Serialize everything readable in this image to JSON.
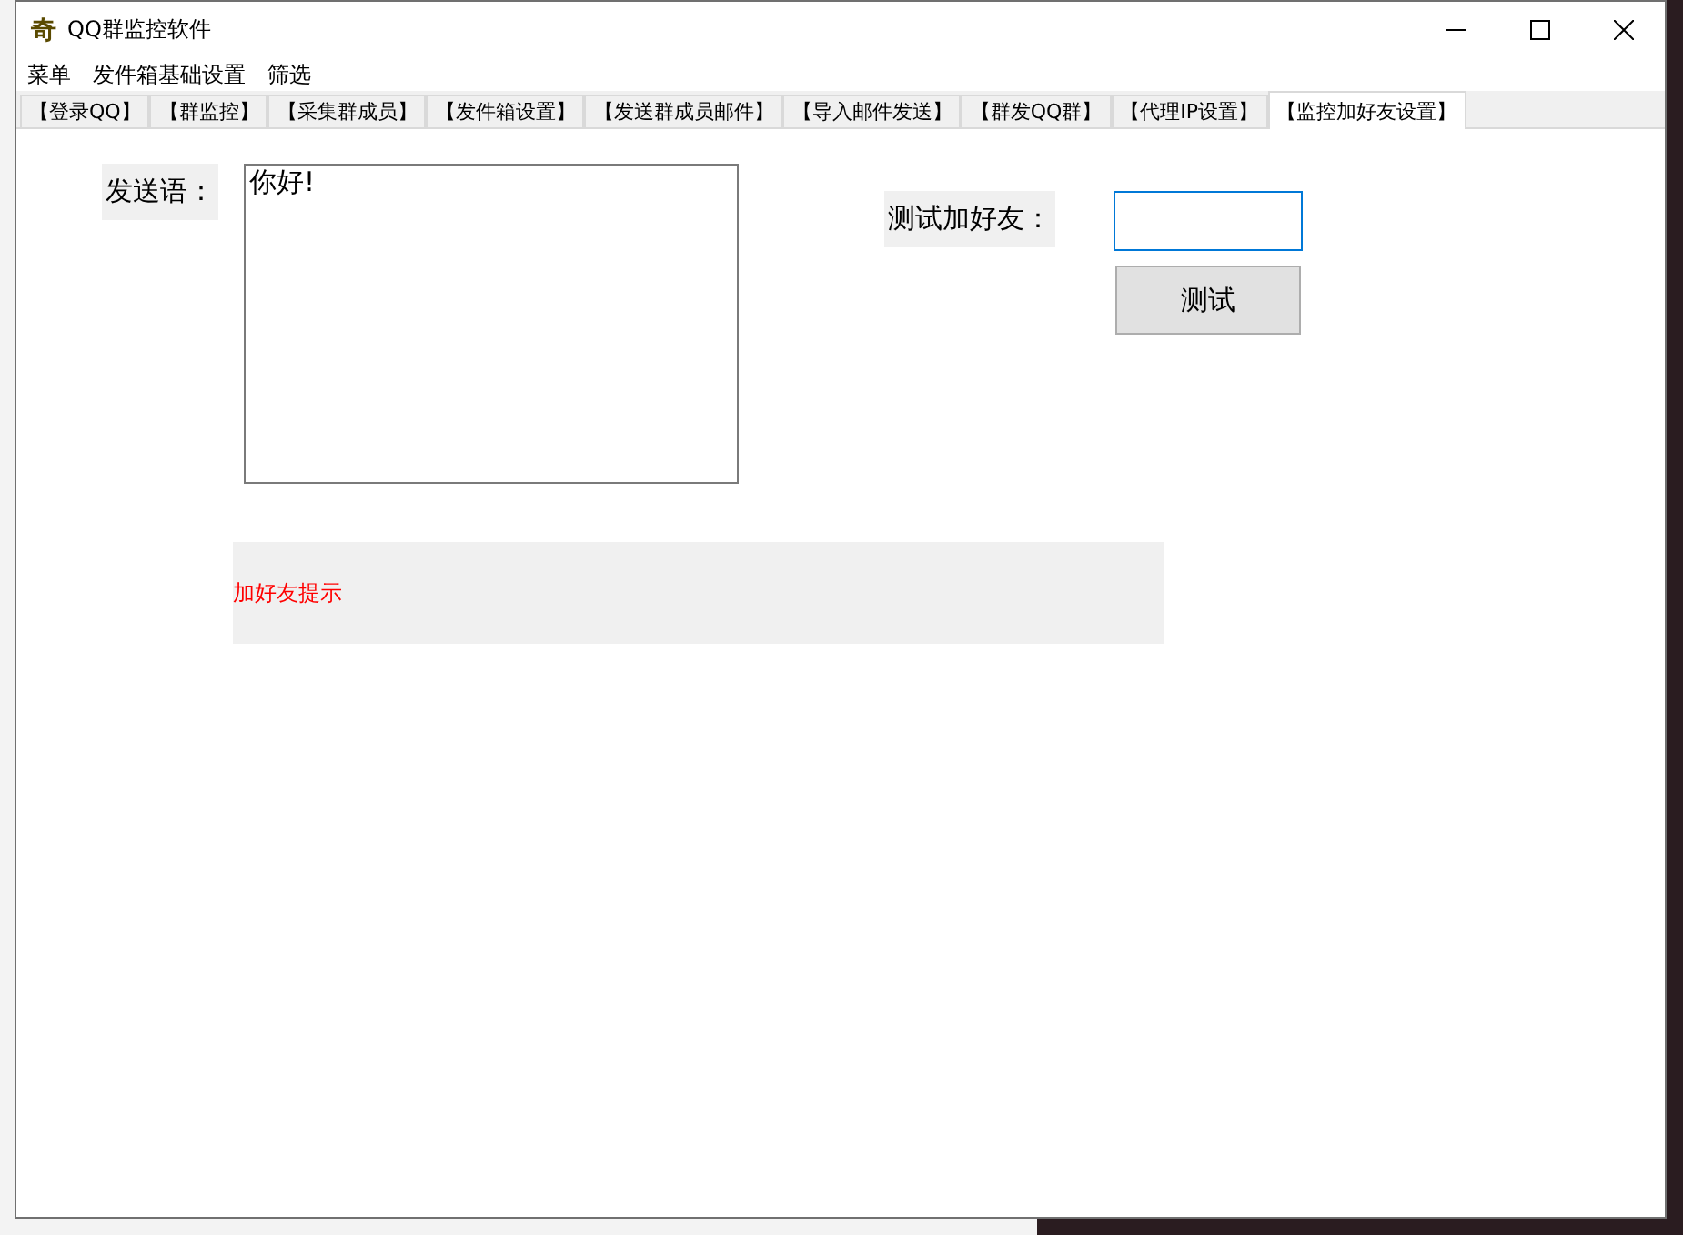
{
  "window": {
    "app_icon": "奇",
    "title": "QQ群监控软件"
  },
  "menu": [
    "菜单",
    "发件箱基础设置",
    "筛选"
  ],
  "tabs": [
    {
      "label": "【登录QQ】",
      "selected": false
    },
    {
      "label": "【群监控】",
      "selected": false
    },
    {
      "label": "【采集群成员】",
      "selected": false
    },
    {
      "label": "【发件箱设置】",
      "selected": false
    },
    {
      "label": "【发送群成员邮件】",
      "selected": false
    },
    {
      "label": "【导入邮件发送】",
      "selected": false
    },
    {
      "label": "【群发QQ群】",
      "selected": false
    },
    {
      "label": "【代理IP设置】",
      "selected": false
    },
    {
      "label": "【监控加好友设置】",
      "selected": true
    }
  ],
  "greeting": {
    "label": "发送语：",
    "value": "你好!"
  },
  "test_add_friend": {
    "label": "测试加好友：",
    "button": "测试"
  },
  "hint": "加好友提示"
}
